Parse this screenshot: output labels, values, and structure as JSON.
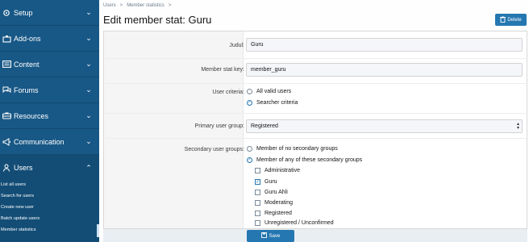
{
  "sidebar": {
    "items": [
      {
        "label": "Setup",
        "icon": "gear-icon"
      },
      {
        "label": "Add-ons",
        "icon": "puzzle-icon"
      },
      {
        "label": "Content",
        "icon": "content-icon"
      },
      {
        "label": "Forums",
        "icon": "comments-icon"
      },
      {
        "label": "Resources",
        "icon": "resources-icon"
      },
      {
        "label": "Communication",
        "icon": "bullhorn-icon"
      },
      {
        "label": "Users",
        "icon": "user-icon"
      }
    ],
    "users_sub": [
      "List all users",
      "Search for users",
      "Create new user",
      "Batch update users",
      "Member statistics"
    ]
  },
  "breadcrumb": {
    "items": [
      "Users",
      "Member statistics"
    ],
    "separator": ">"
  },
  "page_title": "Edit member stat: Guru",
  "delete_label": "Delete",
  "form": {
    "title_label": "Judul:",
    "title_value": "Guru",
    "key_label": "Member stat key:",
    "key_value": "member_guru",
    "criteria_label": "User criteria:",
    "criteria_options": [
      {
        "label": "All valid users",
        "checked": false
      },
      {
        "label": "Searcher criteria",
        "checked": true
      }
    ],
    "primary_label": "Primary user group:",
    "primary_value": "Registered",
    "secondary_label": "Secondary user groups:",
    "secondary_modes": [
      {
        "label": "Member of no secondary groups",
        "checked": false
      },
      {
        "label": "Member of any of these secondary groups",
        "checked": true
      }
    ],
    "groups": [
      {
        "label": "Administrative",
        "checked": false
      },
      {
        "label": "Guru",
        "checked": true
      },
      {
        "label": "Guru Ahli",
        "checked": false
      },
      {
        "label": "Moderating",
        "checked": false
      },
      {
        "label": "Registered",
        "checked": false
      },
      {
        "label": "Unregistered / Unconfirmed",
        "checked": false
      }
    ]
  },
  "save_label": "Save",
  "colors": {
    "sidebar": "#185886",
    "accent": "#2577b1"
  }
}
